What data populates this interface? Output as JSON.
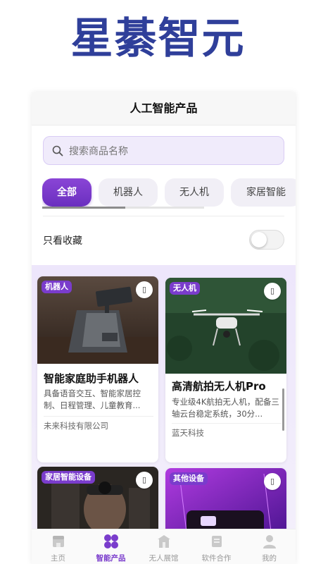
{
  "brand": {
    "title": "星綦智元"
  },
  "header": {
    "title": "人工智能产品"
  },
  "search": {
    "placeholder": "搜索商品名称"
  },
  "categories": [
    {
      "label": "全部",
      "active": true
    },
    {
      "label": "机器人",
      "active": false
    },
    {
      "label": "无人机",
      "active": false
    },
    {
      "label": "家居智能",
      "active": false
    }
  ],
  "favorites_toggle": {
    "label": "只看收藏",
    "on": false
  },
  "products": [
    {
      "tag": "机器人",
      "title": "智能家庭助手机器人",
      "desc": "具备语音交互、智能家居控制、日程管理、儿童教育...",
      "company": "未来科技有限公司",
      "fav_icon": "bookmark-icon"
    },
    {
      "tag": "无人机",
      "title": "高清航拍无人机Pro",
      "desc": "专业级4K航拍无人机，配备三轴云台稳定系统，30分...",
      "company": "蓝天科技",
      "fav_icon": "bookmark-icon"
    },
    {
      "tag": "家居智能设备",
      "title": "",
      "desc": "",
      "company": "",
      "fav_icon": "bookmark-icon"
    },
    {
      "tag": "其他设备",
      "title": "",
      "desc": "",
      "company": "",
      "fav_icon": "bookmark-icon"
    }
  ],
  "tabbar": [
    {
      "label": "主页",
      "icon": "home-icon",
      "active": false
    },
    {
      "label": "智能产品",
      "icon": "grid-icon",
      "active": true
    },
    {
      "label": "无人展馆",
      "icon": "store-icon",
      "active": false
    },
    {
      "label": "软件合作",
      "icon": "handshake-icon",
      "active": false
    },
    {
      "label": "我的",
      "icon": "user-icon",
      "active": false
    }
  ],
  "colors": {
    "accent": "#7a3ccc",
    "brand": "#2f3f9a"
  }
}
